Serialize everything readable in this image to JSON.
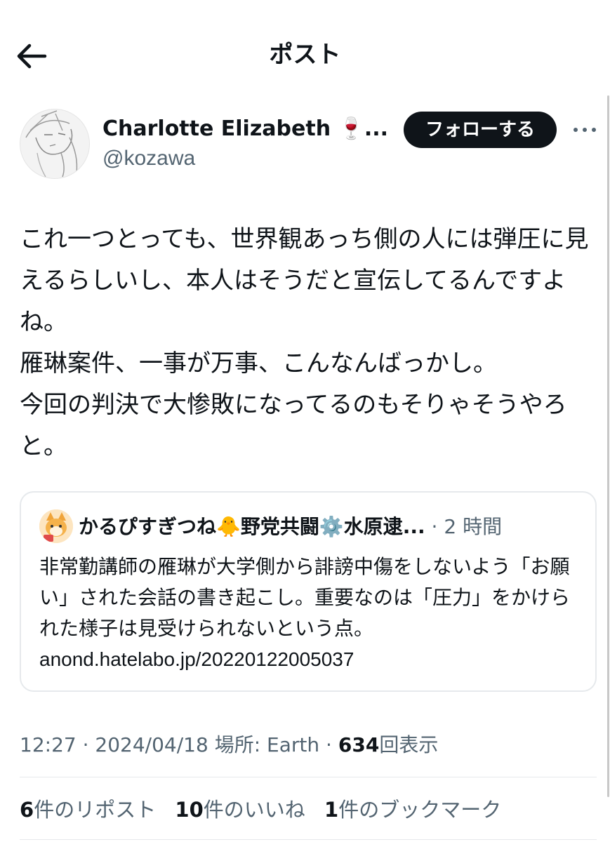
{
  "header": {
    "title": "ポスト"
  },
  "author": {
    "name": "Charlotte Elizabeth 🍷...",
    "handle": "@kozawa",
    "follow_label": "フォローする"
  },
  "post": {
    "text": "これ一つとっても、世界観あっち側の人には弾圧に見えるらしいし、本人はそうだと宣伝してるんですよね。\n雁琳案件、一事が万事、こんなんばっかし。\n今回の判決で大惨敗になってるのもそりゃそうやろと。"
  },
  "quote": {
    "author_name": "かるぴすぎつね🐥野党共闘⚙️水原逮...",
    "separator": "·",
    "time": "2 時間",
    "text": "非常勤講師の雁琳が大学側から誹謗中傷をしないよう「お願い」された会話の書き起こし。重要なのは「圧力」をかけられた様子は見受けられないという点。",
    "link": "anond.hatelabo.jp/20220122005037"
  },
  "meta": {
    "time": "12:27",
    "sep1": "·",
    "date": "2024/04/18",
    "location": "場所: Earth",
    "sep2": "·",
    "views_count": "634",
    "views_label": "回表示"
  },
  "stats": {
    "reposts_count": "6",
    "reposts_label": "件のリポスト",
    "likes_count": "10",
    "likes_label": "件のいいね",
    "bookmarks_count": "1",
    "bookmarks_label": "件のブックマーク"
  },
  "icons": {
    "back": "arrow-left-icon",
    "more": "more-horizontal-icon"
  },
  "colors": {
    "text_primary": "#0f1419",
    "text_secondary": "#536471",
    "follow_button_bg": "#0f1419",
    "divider": "#e6e9ec"
  }
}
